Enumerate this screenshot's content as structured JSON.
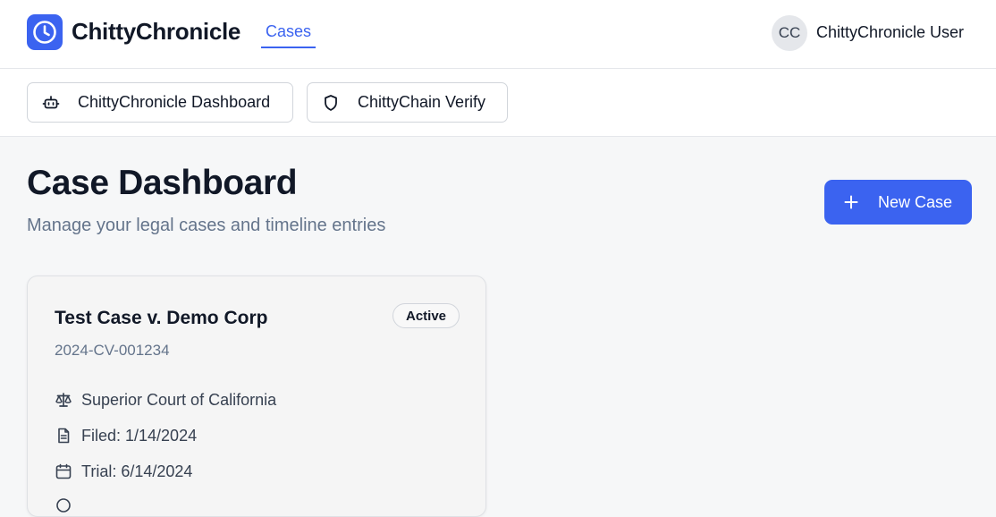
{
  "header": {
    "brand_name": "ChittyChronicle",
    "nav_cases": "Cases",
    "user_initials": "CC",
    "user_name": "ChittyChronicle User"
  },
  "subnav": {
    "dashboard_label": "ChittyChronicle Dashboard",
    "verify_label": "ChittyChain Verify"
  },
  "page": {
    "title": "Case Dashboard",
    "subtitle": "Manage your legal cases and timeline entries",
    "new_case_label": "New Case"
  },
  "cases": [
    {
      "title": "Test Case v. Demo Corp",
      "number": "2024-CV-001234",
      "status": "Active",
      "court": "Superior Court of California",
      "filed": "Filed: 1/14/2024",
      "trial": "Trial: 6/14/2024"
    }
  ],
  "colors": {
    "accent": "#3b63f0",
    "muted_text": "#64748b",
    "background": "#f6f7f8"
  },
  "icons": {
    "brand": "clock-icon",
    "dashboard": "bot-icon",
    "verify": "shield-icon",
    "new_case": "plus-icon",
    "court": "scale-icon",
    "filed": "file-text-icon",
    "trial": "calendar-icon"
  }
}
